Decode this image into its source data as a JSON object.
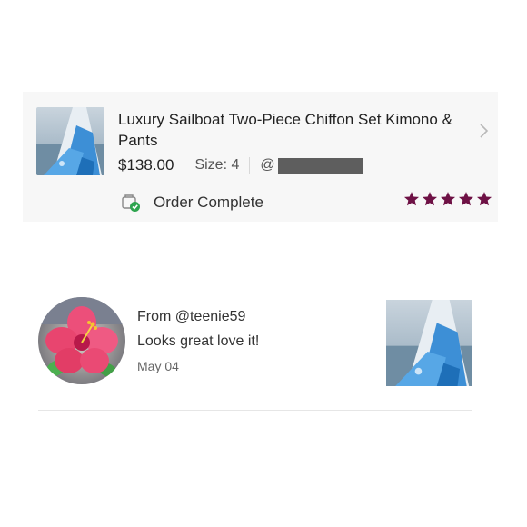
{
  "order": {
    "product_title": "Luxury Sailboat Two-Piece Chiffon Set Kimono & Pants",
    "price": "$138.00",
    "size": "Size: 4",
    "seller_prefix": "@",
    "status": "Order Complete",
    "rating": 5,
    "star_color": "#6e1145"
  },
  "review": {
    "from": "From @teenie59",
    "comment": "Looks great love it!",
    "date": "May 04"
  },
  "icons": [
    "chevron-right-icon",
    "order-complete-icon",
    "star-icon",
    "hibiscus-avatar"
  ]
}
